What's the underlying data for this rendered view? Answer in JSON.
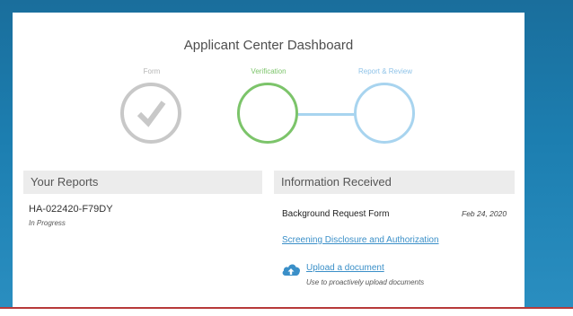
{
  "dashboard": {
    "title": "Applicant Center Dashboard"
  },
  "steps": [
    {
      "label": "Form",
      "state": "complete",
      "color": "#c8c8c8",
      "icon": "checkmark-icon"
    },
    {
      "label": "Verification",
      "state": "current",
      "color": "#7cc46a"
    },
    {
      "label": "Report & Review",
      "state": "pending",
      "color": "#a8d4ef"
    }
  ],
  "reports": {
    "header": "Your Reports",
    "items": [
      {
        "id": "HA-022420-F79DY",
        "status": "In Progress"
      }
    ]
  },
  "info": {
    "header": "Information Received",
    "items": [
      {
        "name": "Background Request Form",
        "date": "Feb 24, 2020"
      }
    ],
    "disclosure_link": "Screening Disclosure and Authorization",
    "upload_link": "Upload a document",
    "upload_hint": "Use to proactively upload documents"
  },
  "colors": {
    "accent_link": "#3a8fc8",
    "background": "#1c7eb0",
    "bottom_rule": "#b73a3a"
  }
}
